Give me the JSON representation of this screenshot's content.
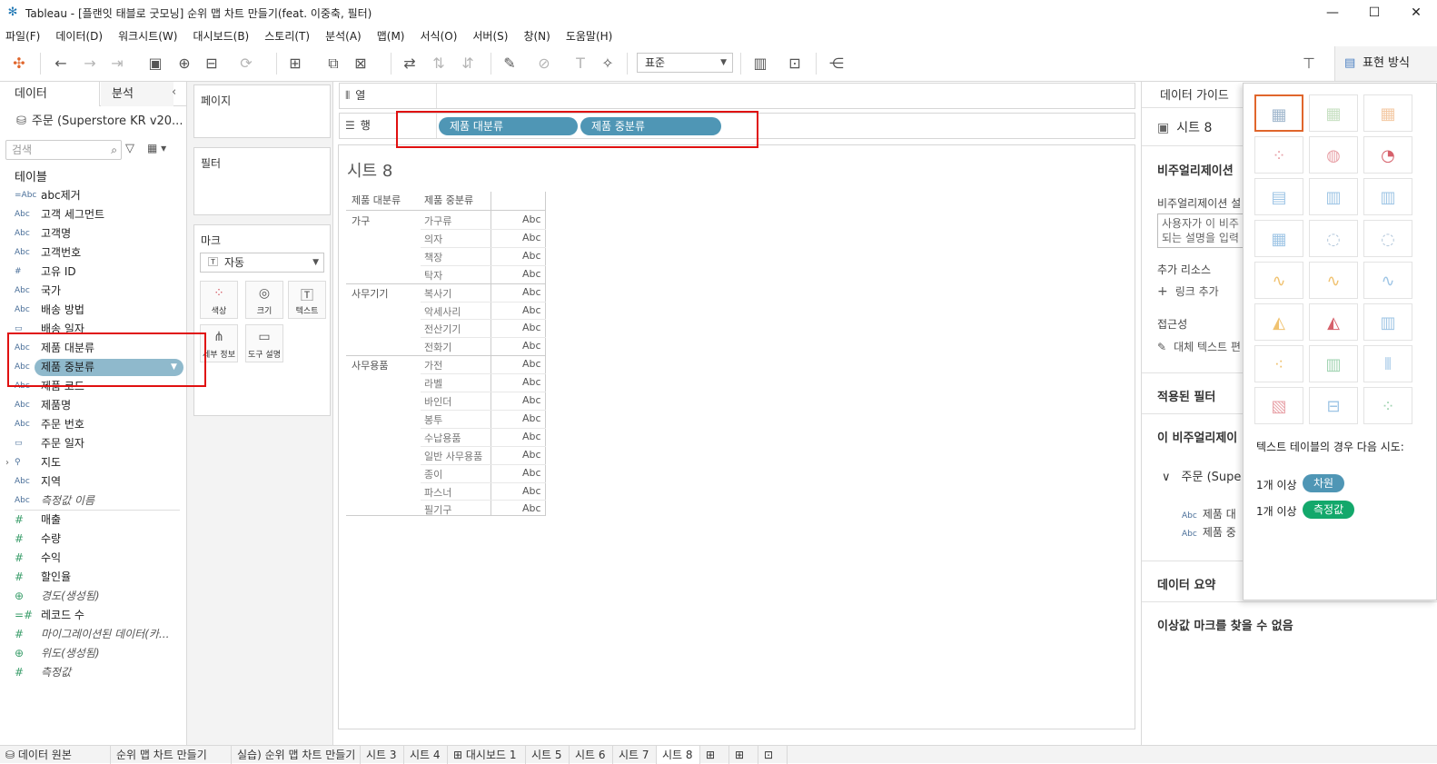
{
  "window": {
    "title": "Tableau - [플랜잇 태블로 굿모닝] 순위 맵 차트 만들기(feat. 이중축, 필터)"
  },
  "menu": [
    "파일(F)",
    "데이터(D)",
    "워크시트(W)",
    "대시보드(B)",
    "스토리(T)",
    "분석(A)",
    "맵(M)",
    "서식(O)",
    "서버(S)",
    "창(N)",
    "도움말(H)"
  ],
  "toolbar": {
    "fit": "표준",
    "show_me": "표현 방식"
  },
  "data_pane": {
    "tab_data": "데이터",
    "tab_analytics": "분석",
    "source": "주문 (Superstore KR v20...",
    "search_placeholder": "검색",
    "tables_label": "테이블",
    "fields": [
      {
        "type": "=Abc",
        "name": "abc제거"
      },
      {
        "type": "Abc",
        "name": "고객 세그먼트"
      },
      {
        "type": "Abc",
        "name": "고객명"
      },
      {
        "type": "Abc",
        "name": "고객번호"
      },
      {
        "type": "#",
        "name": "고유 ID"
      },
      {
        "type": "Abc",
        "name": "국가"
      },
      {
        "type": "Abc",
        "name": "배송 방법"
      },
      {
        "type": "▭",
        "name": "배송 일자"
      },
      {
        "type": "Abc",
        "name": "제품 대분류"
      },
      {
        "type": "Abc",
        "name": "제품 중분류"
      },
      {
        "type": "Abc",
        "name": "제품 코드"
      },
      {
        "type": "Abc",
        "name": "제품명"
      },
      {
        "type": "Abc",
        "name": "주문 번호"
      },
      {
        "type": "▭",
        "name": "주문 일자"
      },
      {
        "type": "⚲",
        "name": "지도"
      },
      {
        "type": "Abc",
        "name": "지역"
      },
      {
        "type": "Abc",
        "name": "측정값 이름"
      }
    ],
    "measures": [
      {
        "type": "#",
        "name": "매출"
      },
      {
        "type": "#",
        "name": "수량"
      },
      {
        "type": "#",
        "name": "수익"
      },
      {
        "type": "#",
        "name": "할인율"
      },
      {
        "type": "⊕",
        "name": "경도(생성됨)"
      },
      {
        "type": "=#",
        "name": "레코드 수"
      },
      {
        "type": "#",
        "name": "마이그레이션된 데이터(카..."
      },
      {
        "type": "⊕",
        "name": "위도(생성됨)"
      },
      {
        "type": "#",
        "name": "측정값"
      }
    ]
  },
  "cards": {
    "pages": "페이지",
    "filters": "필터",
    "marks": "마크",
    "mark_type": "자동",
    "mark_buttons": [
      "색상",
      "크기",
      "텍스트",
      "세부 정보",
      "도구 설명"
    ]
  },
  "shelves": {
    "columns_label": "열",
    "rows_label": "행",
    "row_pills": [
      "제품 대분류",
      "제품 중분류"
    ]
  },
  "view": {
    "sheet_title": "시트 8",
    "headers": [
      "제품 대분류",
      "제품 중분류"
    ],
    "groups": [
      {
        "name": "가구",
        "items": [
          "가구류",
          "의자",
          "책장",
          "탁자"
        ]
      },
      {
        "name": "사무기기",
        "items": [
          "복사기",
          "악세사리",
          "전산기기",
          "전화기"
        ]
      },
      {
        "name": "사무용품",
        "items": [
          "가전",
          "라벨",
          "바인더",
          "봉투",
          "수납용품",
          "일반 사무용품",
          "종이",
          "파스너",
          "필기구"
        ]
      }
    ],
    "cell_value": "Abc"
  },
  "guide": {
    "title": "데이터 가이드",
    "sheet": "시트 8",
    "viz_heading": "비주얼리제이션",
    "viz_desc_label": "비주얼리제이션 설",
    "viz_desc_placeholder_1": "사용자가 이 비주",
    "viz_desc_placeholder_2": "되는 설명을 입력",
    "resources": "추가 리소스",
    "add_link": "링크 추가",
    "accessibility": "접근성",
    "alt_text": "대체 텍스트 편",
    "applied_filters": "적용된 필터",
    "this_viz": "이 비주얼리제이",
    "source_node": "주문 (Supe",
    "node_fields": [
      "제품 대",
      "제품 중"
    ],
    "data_summary": "데이터 요약",
    "outliers": "이상값 마크를 찾을 수 없음"
  },
  "show_me": {
    "hint": "텍스트 테이블의 경우 다음 시도:",
    "req1_prefix": "1개 이상",
    "req1_chip": "차원",
    "req2_prefix": "1개 이상",
    "req2_chip": "측정값",
    "dim_color": "#4f96b5",
    "meas_color": "#13a86b"
  },
  "tabs": [
    "데이터 원본",
    "순위 맵 차트 만들기",
    "실습) 순위 맵 차트 만들기",
    "시트 3",
    "시트 4",
    "대시보드 1",
    "시트 5",
    "시트 6",
    "시트 7",
    "시트 8"
  ]
}
